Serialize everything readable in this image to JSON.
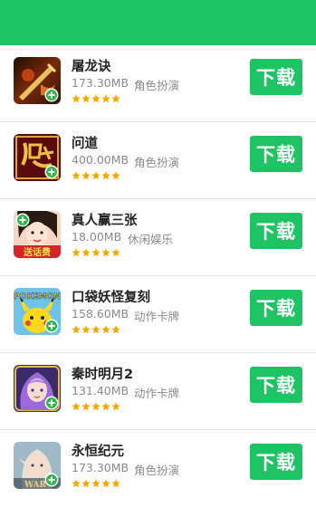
{
  "header": {
    "color": "#1ec463"
  },
  "accent": "#1ec463",
  "star_color": "#f2a800",
  "apps": [
    {
      "name": "屠龙诀",
      "size": "173.30MB",
      "category": "角色扮演",
      "rating": 5,
      "icon": "dragon-sword-icon",
      "download_label": "下载"
    },
    {
      "name": "问道",
      "size": "400.00MB",
      "category": "角色扮演",
      "rating": 5,
      "icon": "wendao-calligraphy-icon",
      "download_label": "下载"
    },
    {
      "name": "真人赢三张",
      "size": "18.00MB",
      "category": "休闲娱乐",
      "rating": 5,
      "icon": "card-girl-icon",
      "download_label": "下载"
    },
    {
      "name": "口袋妖怪复刻",
      "size": "158.60MB",
      "category": "动作卡牌",
      "rating": 5,
      "icon": "pikachu-icon",
      "download_label": "下载"
    },
    {
      "name": "秦时明月2",
      "size": "131.40MB",
      "category": "动作卡牌",
      "rating": 5,
      "icon": "purple-hair-girl-icon",
      "download_label": "下载"
    },
    {
      "name": "永恒纪元",
      "size": "173.30MB",
      "category": "角色扮演",
      "rating": 5,
      "icon": "elf-warrior-icon",
      "download_label": "下载"
    }
  ]
}
